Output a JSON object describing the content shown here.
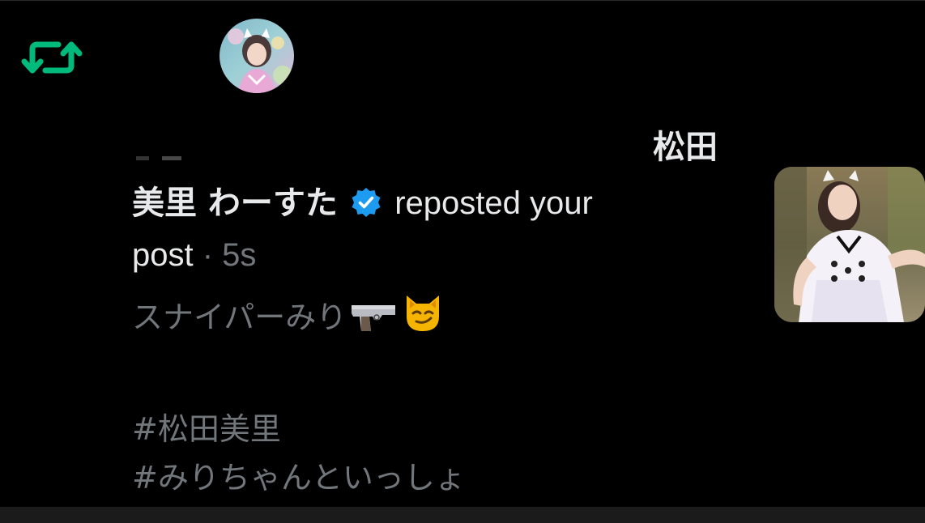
{
  "notification": {
    "icon": "repost-icon",
    "icon_color": "#00ba7c",
    "user_name": "美里 わーすた",
    "verified_icon": "verified-badge-icon",
    "verified_color": "#1d9bf0",
    "action_text": "reposted your",
    "action_text_2": "post",
    "separator": " · ",
    "timestamp": "5s"
  },
  "overlay": {
    "name": "松田"
  },
  "post": {
    "line1": "スナイパーみり",
    "line1_emojis": [
      "pistol-emoji",
      "smirking-cat-emoji"
    ],
    "hashtag1": "#松田美里",
    "hashtag2": "#みりちゃんといっしょ"
  },
  "colors": {
    "background": "#000000",
    "primary_text": "#e7e9ea",
    "secondary_text": "#71767b"
  }
}
